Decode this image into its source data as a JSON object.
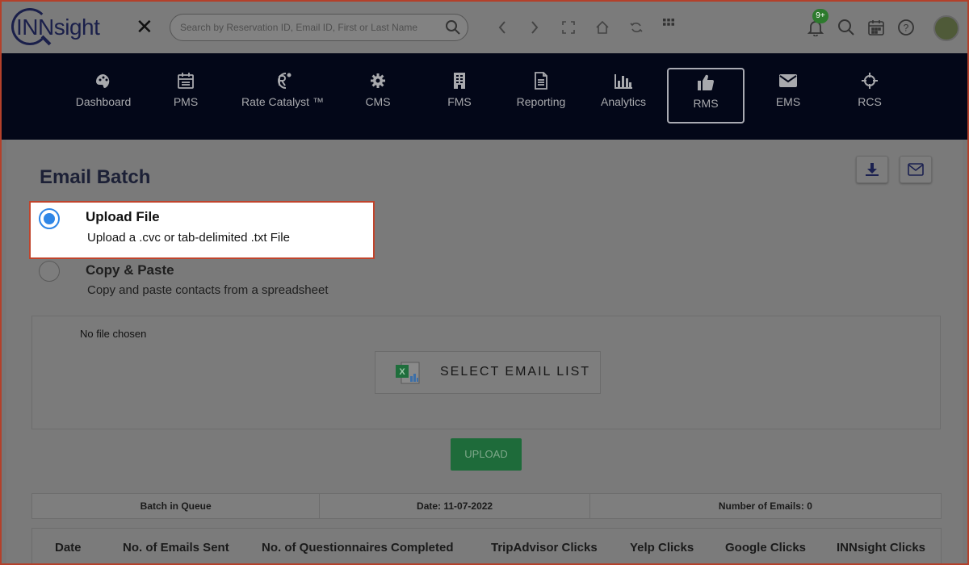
{
  "app": {
    "logo_text": "INNsight"
  },
  "search": {
    "placeholder": "Search by Reservation ID, Email ID, First or Last Name"
  },
  "toolbar": {
    "icons": [
      "chevron-left-icon",
      "chevron-right-icon",
      "expand-icon",
      "home-icon",
      "refresh-icon",
      "apps-grid-icon"
    ],
    "notification_badge": "9+"
  },
  "nav": {
    "items": [
      {
        "label": "Dashboard",
        "icon": "palette-icon"
      },
      {
        "label": "PMS",
        "icon": "calendar-icon"
      },
      {
        "label": "Rate Catalyst ™",
        "icon": "rate-catalyst-icon"
      },
      {
        "label": "CMS",
        "icon": "gear-icon"
      },
      {
        "label": "FMS",
        "icon": "building-icon"
      },
      {
        "label": "Reporting",
        "icon": "document-icon"
      },
      {
        "label": "Analytics",
        "icon": "bar-chart-icon"
      },
      {
        "label": "RMS",
        "icon": "thumbs-up-icon"
      },
      {
        "label": "EMS",
        "icon": "envelope-icon"
      },
      {
        "label": "RCS",
        "icon": "crosshair-icon"
      }
    ],
    "active": "RMS"
  },
  "main": {
    "title": "Email Batch",
    "options": [
      {
        "title": "Upload File",
        "subtitle": "Upload a .cvc or tab-delimited .txt File",
        "selected": true
      },
      {
        "title": "Copy & Paste",
        "subtitle": "Copy and paste contacts from a spreadsheet",
        "selected": false
      }
    ],
    "file_status": "No file chosen",
    "select_label": "SELECT EMAIL LIST",
    "upload_label": "UPLOAD",
    "queue": {
      "batch": "Batch in Queue",
      "date": "Date: 11-07-2022",
      "count": "Number of Emails: 0"
    },
    "columns": [
      "Date",
      "No. of Emails Sent",
      "No. of Questionnaires Completed",
      "TripAdvisor Clicks",
      "Yelp Clicks",
      "Google Clicks",
      "INNsight Clicks"
    ]
  },
  "colors": {
    "accent": "#2f86e6",
    "nav_bg": "#030718",
    "highlight": "#c0442c",
    "upload": "#1e6b3a"
  }
}
